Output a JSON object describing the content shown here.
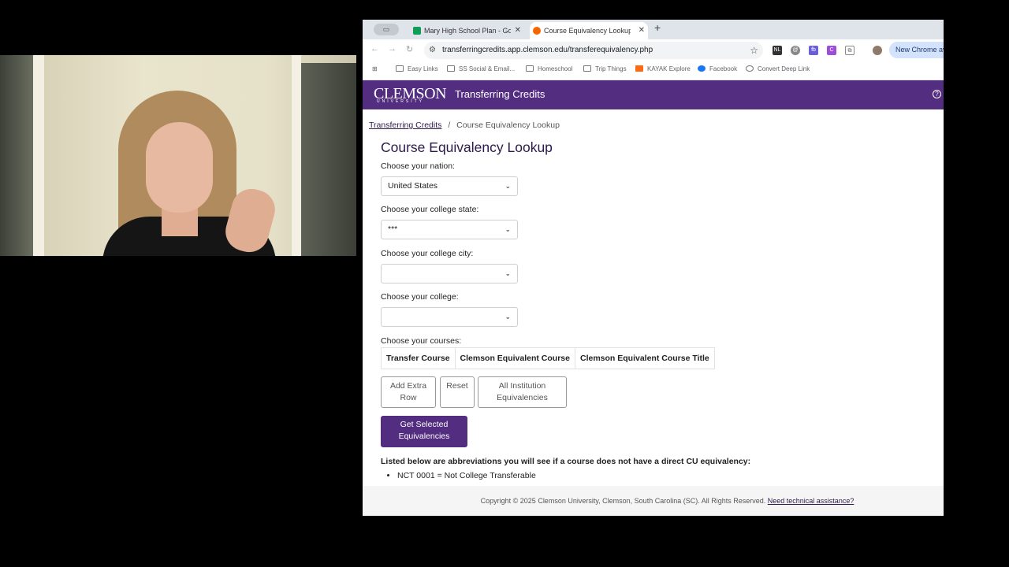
{
  "browser": {
    "tabs": [
      {
        "title": "Mary High School Plan - Goo",
        "favicon_color": "#0f9d58",
        "active": false
      },
      {
        "title": "Course Equivalency Lookup",
        "favicon_color": "#f56600",
        "active": true
      }
    ],
    "url": "transferringcredits.app.clemson.edu/transferequivalency.php",
    "new_chrome_label": "New Chrome av",
    "bookmarks": [
      "Easy Links",
      "SS Social & Email...",
      "Homeschool",
      "Trip Things",
      "KAYAK Explore",
      "Facebook",
      "Convert Deep Link"
    ]
  },
  "site": {
    "logo": "CLEMSON",
    "logo_sub": "UNIVERSITY",
    "title": "Transferring Credits",
    "brand_color": "#522d80"
  },
  "breadcrumb": {
    "link": "Transferring Credits",
    "separator": "/",
    "current": "Course Equivalency Lookup"
  },
  "page": {
    "heading": "Course Equivalency Lookup",
    "nation_label": "Choose your nation:",
    "nation_value": "United States",
    "state_label": "Choose your college state:",
    "state_value": "***",
    "city_label": "Choose your college city:",
    "city_value": "",
    "college_label": "Choose your college:",
    "college_value": "",
    "courses_label": "Choose your courses:",
    "table_headers": [
      "Transfer Course",
      "Clemson Equivalent Course",
      "Clemson Equivalent Course Title"
    ],
    "buttons": {
      "add_row_line1": "Add Extra",
      "add_row_line2": "Row",
      "reset": "Reset",
      "all_line1": "All Institution",
      "all_line2": "Equivalencies",
      "get_line1": "Get Selected",
      "get_line2": "Equivalencies"
    },
    "abbrev_note": "Listed below are abbreviations you will see if a course does not have a direct CU equivalency:",
    "abbreviations": [
      "NCT 0001 = Not College Transferable"
    ]
  },
  "footer": {
    "copyright": "Copyright © 2025 Clemson University, Clemson, South Carolina (SC). All Rights Reserved.",
    "help_link": "Need technical assistance?"
  }
}
